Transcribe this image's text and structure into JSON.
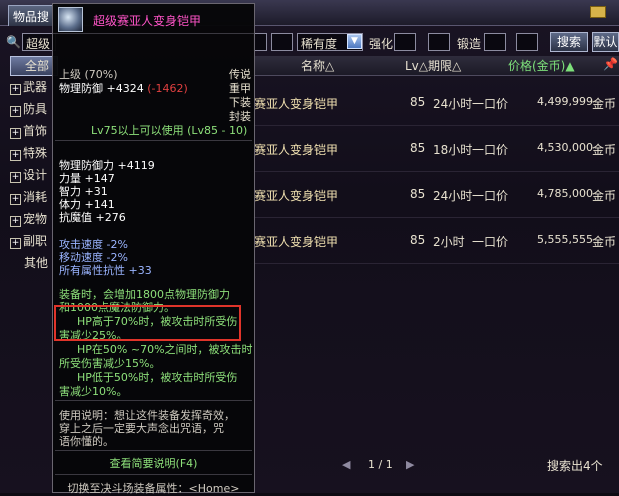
{
  "tab": {
    "label": "物品搜"
  },
  "filter": {
    "level_value": "超级",
    "rarity_label": "稀有度",
    "enhance_label": "强化",
    "lock_label": "锻造",
    "search_button": "搜索",
    "default_button": "默认"
  },
  "categories": [
    {
      "label": "全部",
      "has_plus": false,
      "active": true
    },
    {
      "label": "武器",
      "has_plus": true
    },
    {
      "label": "防具",
      "has_plus": true
    },
    {
      "label": "首饰",
      "has_plus": true
    },
    {
      "label": "特殊",
      "has_plus": true
    },
    {
      "label": "设计",
      "has_plus": true
    },
    {
      "label": "消耗",
      "has_plus": true
    },
    {
      "label": "宠物",
      "has_plus": true
    },
    {
      "label": "副职",
      "has_plus": true
    },
    {
      "label": "其他",
      "has_plus": false
    }
  ],
  "columns": {
    "name": "名称△",
    "level": "Lv△期限△",
    "price": "价格(金币)▲",
    "pin_icon": "pin-icon"
  },
  "rows": [
    {
      "name": "赛亚人变身铠甲",
      "level": "85",
      "time": "24小时",
      "bid": "一口价",
      "price": "4,499,999",
      "currency": "金币"
    },
    {
      "name": "赛亚人变身铠甲",
      "level": "85",
      "time": "18小时",
      "bid": "一口价",
      "price": "4,530,000",
      "currency": "金币"
    },
    {
      "name": "赛亚人变身铠甲",
      "level": "85",
      "time": "24小时",
      "bid": "一口价",
      "price": "4,785,000",
      "currency": "金币"
    },
    {
      "name": "赛亚人变身铠甲",
      "level": "85",
      "time": "2小时",
      "bid": "一口价",
      "price": "5,555,555",
      "currency": "金币"
    }
  ],
  "pager": {
    "text": "1 / 1"
  },
  "search_count": "搜索出4个",
  "tooltip": {
    "title": "超级赛亚人变身铠甲",
    "grade": "上级 (70%)",
    "rarity": "传说",
    "phys_def": "物理防御 +4324",
    "phys_def_delta": "(-1462)",
    "type1": "重甲",
    "type2": "下装",
    "type3": "封装",
    "level_req": "Lv75以上可以使用 (Lv85 - 10)",
    "stats": [
      "物理防御力 +4119",
      "力量 +147",
      "智力 +31",
      "体力 +141",
      "抗魔值 +276"
    ],
    "stats2": [
      "攻击速度 -2%",
      "移动速度 -2%",
      "所有属性抗性 +33"
    ],
    "equip_effect_1": "装备时，会增加1800点物理防御力",
    "equip_effect_2": "和1000点魔法防御力。",
    "hp70_line1": "HP高于70%时，被攻击时所受伤",
    "hp70_line2": "害减少25%。",
    "hp50_line1": "HP在50% ~70%之间时，被攻击时",
    "hp50_line2": "所受伤害减少15%。",
    "hp_low_line1": "HP低于50%时，被攻击时所受伤",
    "hp_low_line2": "害减少10%。",
    "usage_line1": "使用说明：想让这件装备发挥奇效，",
    "usage_line2": "穿上之后一定要大声念出咒语，咒",
    "usage_line3": "语你懂的。",
    "detail_link": "查看简要说明(F4)",
    "switch_text": "切换至决斗场装备属性：<Home>"
  }
}
